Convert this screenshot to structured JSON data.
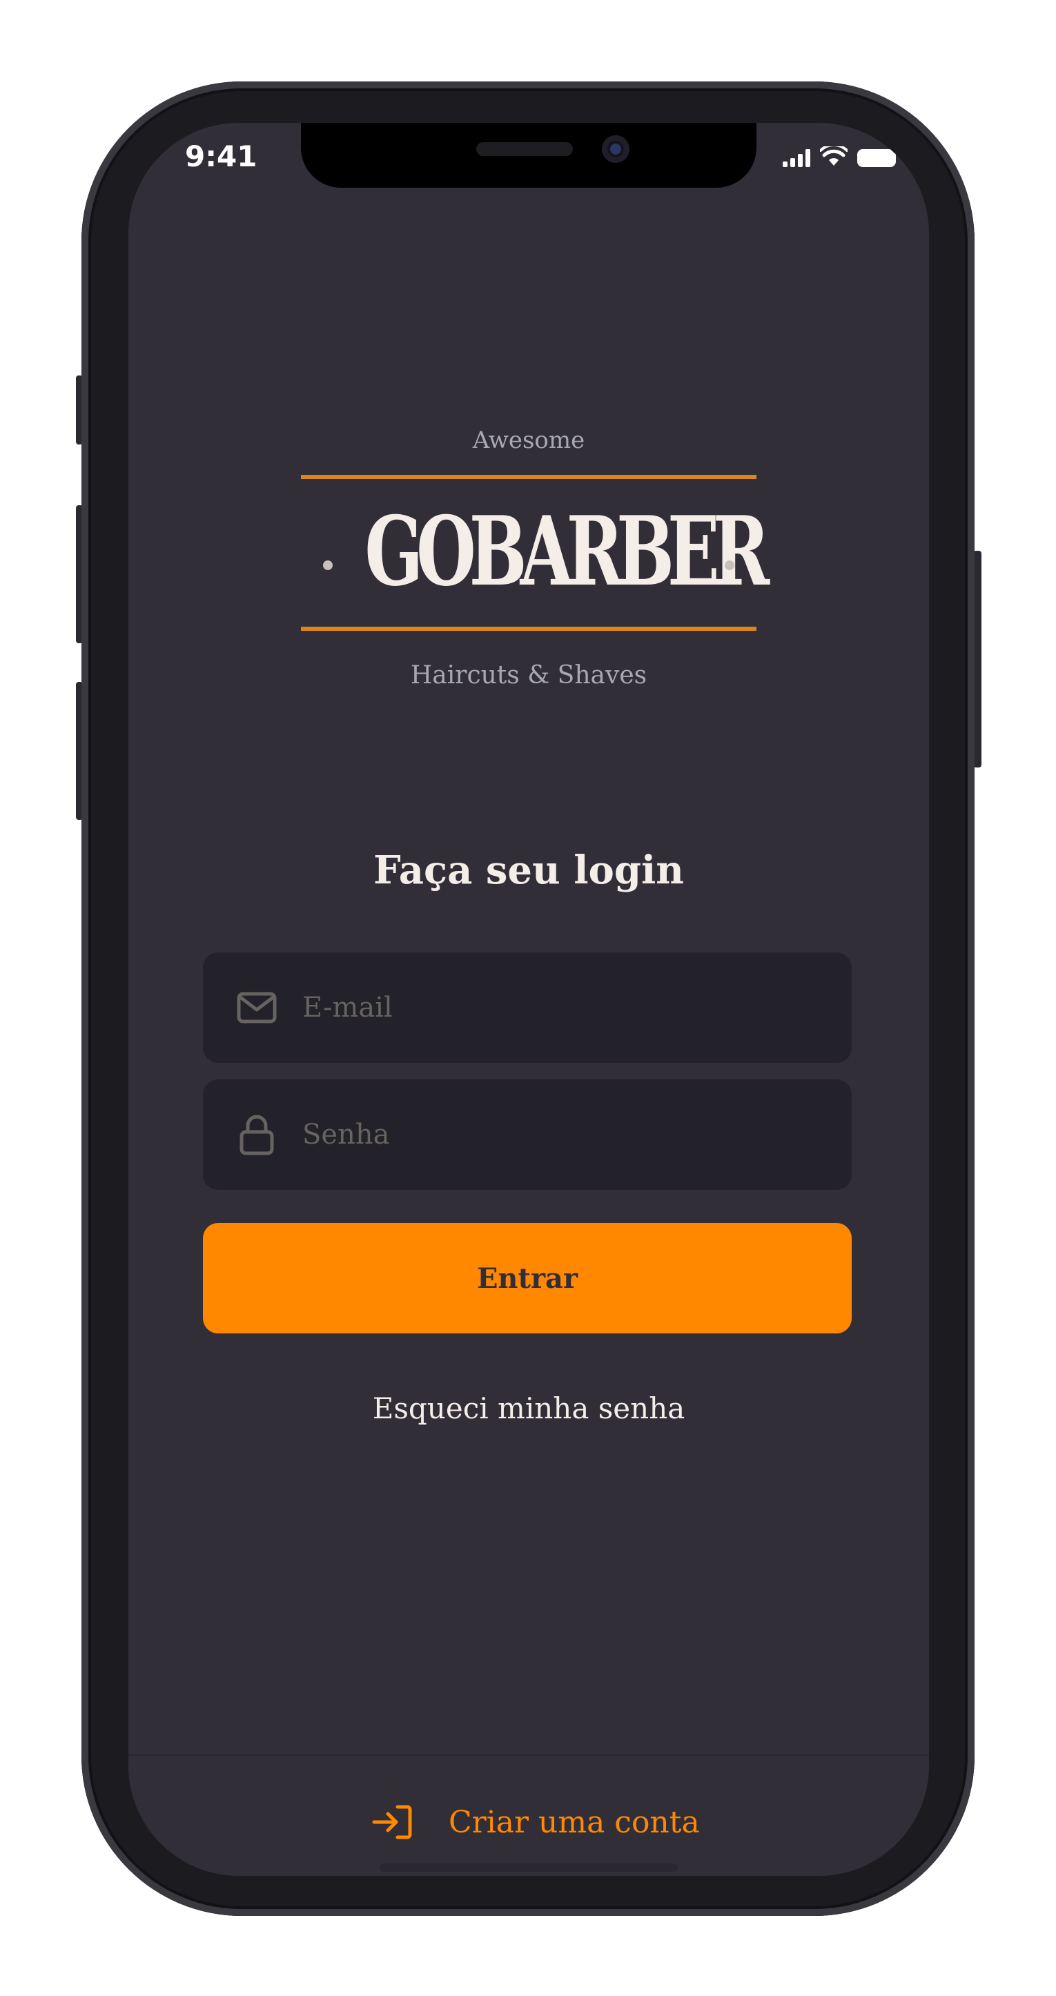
{
  "status_bar": {
    "time": "9:41",
    "icons": [
      "cellular-signal-icon",
      "wifi-icon",
      "battery-icon"
    ]
  },
  "logo": {
    "top_text": "Awesome",
    "name": "GOBARBER",
    "bottom_text": "Haircuts & Shaves"
  },
  "login": {
    "title": "Faça seu login",
    "email_placeholder": "E-mail",
    "email_icon": "mail-icon",
    "password_placeholder": "Senha",
    "password_icon": "lock-icon",
    "submit_label": "Entrar",
    "forgot_label": "Esqueci minha senha"
  },
  "footer": {
    "create_account_label": "Criar uma conta",
    "create_account_icon": "log-in-icon"
  },
  "colors": {
    "background": "#312e38",
    "input_background": "#232129",
    "accent": "#ff8800",
    "text": "#f4ede8",
    "muted_text": "#666360"
  }
}
